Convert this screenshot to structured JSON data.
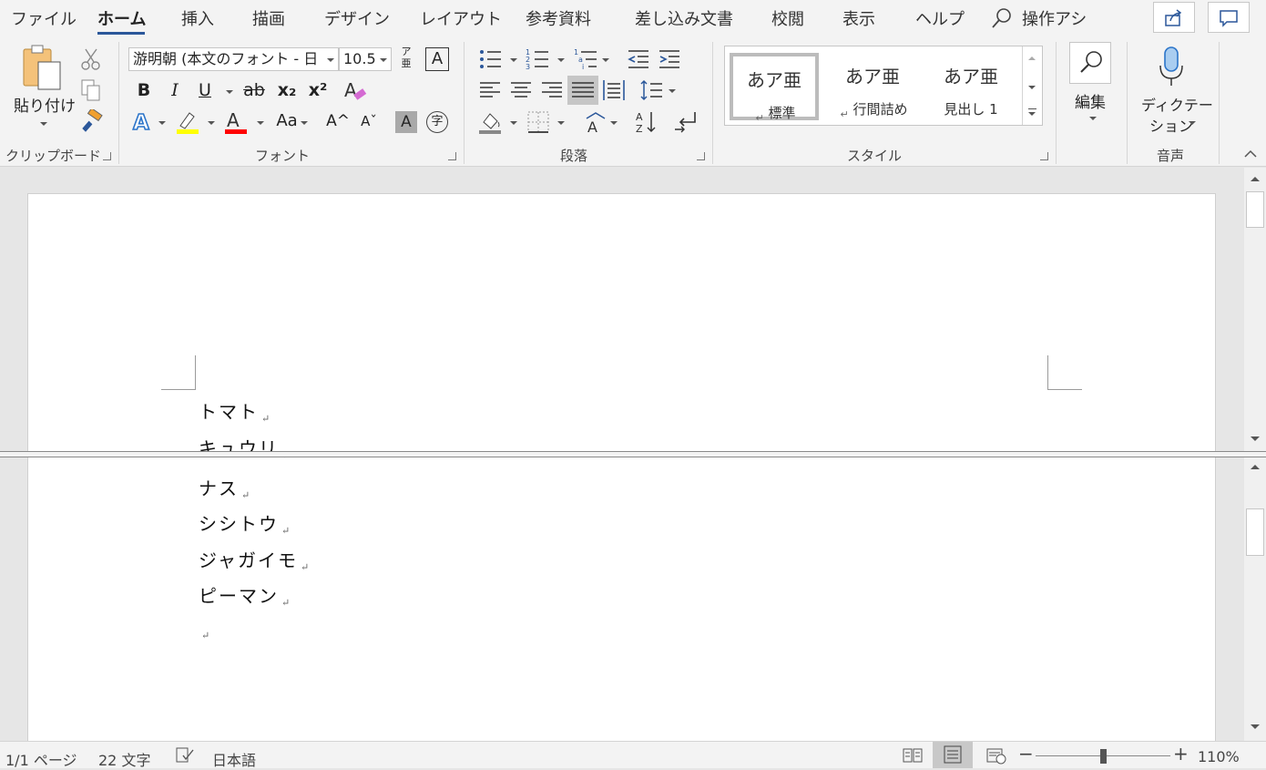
{
  "tabs": [
    "ファイル",
    "ホーム",
    "挿入",
    "描画",
    "デザイン",
    "レイアウト",
    "参考資料",
    "差し込み文書",
    "校閲",
    "表示",
    "ヘルプ"
  ],
  "active_tab": "ホーム",
  "tell_me": "操作アシ",
  "clipboard": {
    "paste_label": "貼り付け",
    "group_label": "クリップボード"
  },
  "font": {
    "name": "游明朝 (本文のフォント - 日",
    "size": "10.5",
    "group_label": "フォント",
    "furigana": "ア\n亜",
    "bold": "B",
    "italic": "I",
    "underline": "U",
    "strike": "ab",
    "subscript": "x₂",
    "superscript": "x²",
    "grow": "A^",
    "shrink": "Aˇ",
    "case": "Aa",
    "char_shade": "A",
    "enclose": "字"
  },
  "paragraph": {
    "group_label": "段落"
  },
  "styles": {
    "group_label": "スタイル",
    "items": [
      {
        "sample": "あア亜",
        "name": "標準",
        "selected": true
      },
      {
        "sample": "あア亜",
        "name": "行間詰め"
      },
      {
        "sample": "あア亜",
        "name": "見出し 1"
      }
    ]
  },
  "editing": {
    "label": "編集"
  },
  "voice": {
    "line1": "ディクテー",
    "line2": "ション",
    "group_label": "音声"
  },
  "document": {
    "lines": [
      "トマト",
      "キュウリ",
      "ナス",
      "シシトウ",
      "ジャガイモ",
      "ピーマン",
      ""
    ],
    "pilcrow": "↵"
  },
  "status": {
    "page": "1/1 ページ",
    "words": "22 文字",
    "language": "日本語",
    "zoom": "110%"
  },
  "colors": {
    "accent": "#2b579a",
    "highlight": "#ffff00",
    "font_color": "#ff0000"
  }
}
